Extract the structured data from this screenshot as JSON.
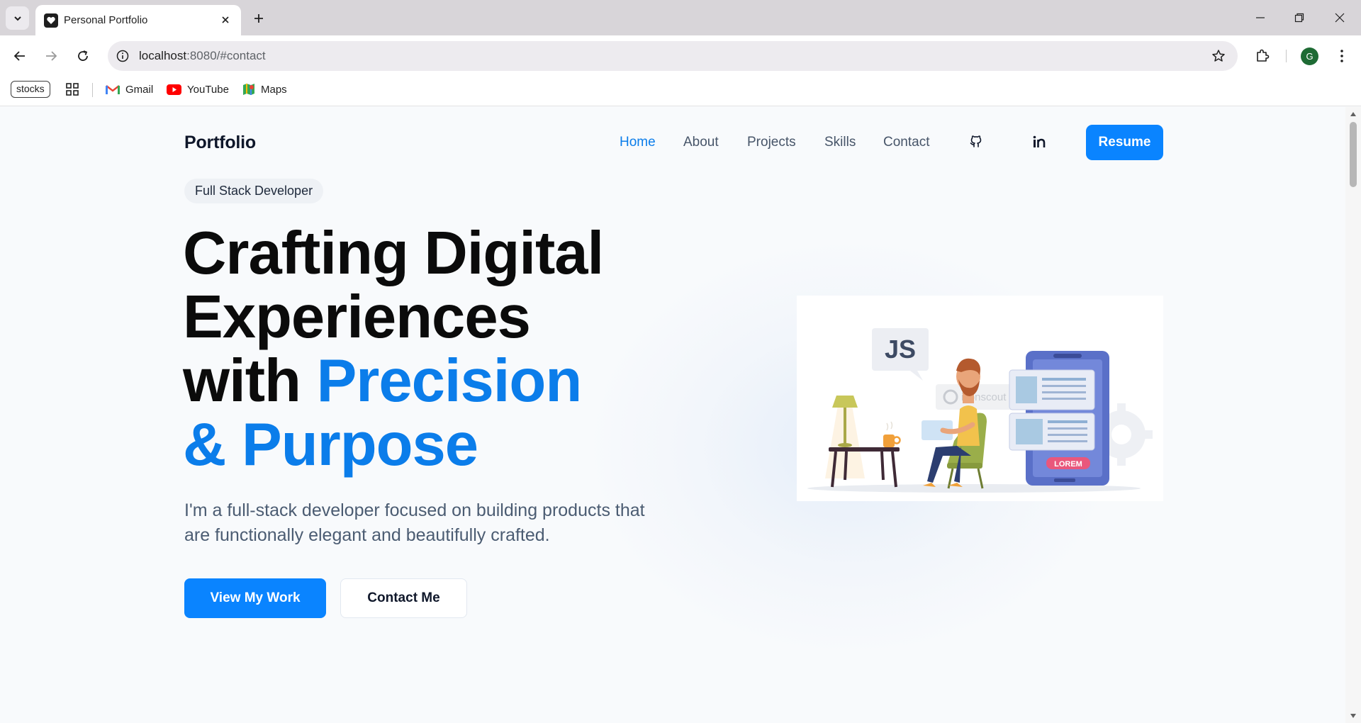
{
  "browser": {
    "tab_title": "Personal Portfolio",
    "url_host": "localhost",
    "url_path": ":8080/#contact",
    "avatar_letter": "G",
    "bookmarks": [
      {
        "label": "stocks"
      },
      {
        "label": "Gmail",
        "icon": "gmail-icon"
      },
      {
        "label": "YouTube",
        "icon": "youtube-icon"
      },
      {
        "label": "Maps",
        "icon": "maps-icon"
      }
    ]
  },
  "site": {
    "brand": "Portfolio",
    "nav": [
      {
        "label": "Home",
        "active": true
      },
      {
        "label": "About",
        "active": false
      },
      {
        "label": "Projects",
        "active": false
      },
      {
        "label": "Skills",
        "active": false
      },
      {
        "label": "Contact",
        "active": false
      }
    ],
    "social_icons": [
      "github-icon",
      "linkedin-icon"
    ],
    "resume_label": "Resume"
  },
  "hero": {
    "badge": "Full Stack Developer",
    "title_line1": "Crafting Digital",
    "title_line2": "Experiences",
    "title_line3_plain": "with ",
    "title_line3_accent": "Precision",
    "title_line4_accent": "& Purpose",
    "subtitle": "I'm a full-stack developer focused on building products that are functionally elegant and beautifully crafted.",
    "primary_cta": "View My Work",
    "secondary_cta": "Contact Me",
    "illustration": {
      "speech_bubble": "JS",
      "phone_button": "LOREM",
      "watermark": "iconscout"
    }
  },
  "colors": {
    "accent": "#0b7dea",
    "button": "#0a84ff",
    "text_dark": "#0b0b0b",
    "text_muted": "#4b5c72"
  }
}
